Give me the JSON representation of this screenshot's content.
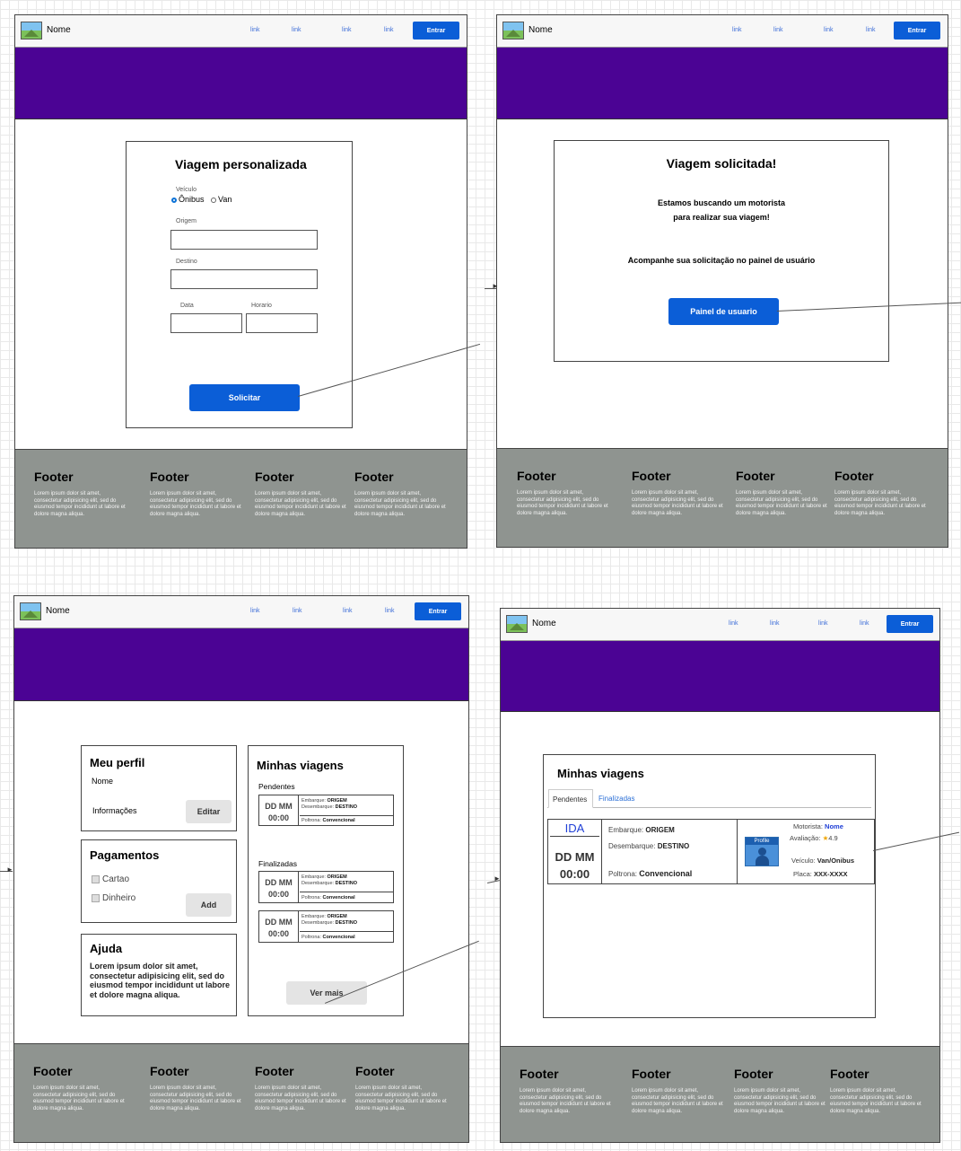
{
  "navbar": {
    "brand": "Nome",
    "links": [
      "link",
      "link",
      "link",
      "link"
    ],
    "login_button": "Entrar"
  },
  "footer": {
    "column_title": "Footer",
    "column_text": "Lorem ipsum dolor sit amet, consectetur adipisicing elit, sed do eiusmod tempor incididunt ut labore et dolore magna aliqua."
  },
  "screen1": {
    "title": "Viagem personalizada",
    "vehicle_label": "Veículo",
    "vehicle_options": [
      "Ônibus",
      "Van"
    ],
    "origin_label": "Origem",
    "destination_label": "Destino",
    "date_label": "Data",
    "time_label": "Horario",
    "submit_button": "Solicitar"
  },
  "screen2": {
    "title": "Viagem solicitada!",
    "message_line1": "Estamos buscando um motorista",
    "message_line2": "para realizar sua viagem!",
    "follow_text": "Acompanhe sua solicitação no painel de usuário",
    "panel_button": "Painel de usuario"
  },
  "screen3": {
    "profile": {
      "title": "Meu perfil",
      "name": "Nome",
      "info": "Informações",
      "edit_button": "Editar"
    },
    "payments": {
      "title": "Pagamentos",
      "options": [
        "Cartao",
        "Dinheiro"
      ],
      "add_button": "Add"
    },
    "help": {
      "title": "Ajuda",
      "text": "Lorem ipsum dolor sit amet, consectetur adipisicing elit, sed do eiusmod tempor incididunt ut labore et dolore magna aliqua."
    },
    "trips": {
      "title": "Minhas viagens",
      "pending_label": "Pendentes",
      "finished_label": "Finalizadas",
      "trip_day": "DD MM",
      "trip_time": "00:00",
      "boarding_label": "Embarque:",
      "boarding_value": "ORIGEM",
      "landing_label": "Desembarque:",
      "landing_value": "DESTINO",
      "seat_label": "Poltrona:",
      "seat_value": "Convencional",
      "more_button": "Ver mais"
    }
  },
  "screen4": {
    "title": "Minhas viagens",
    "tabs": [
      "Pendentes",
      "Finalizadas"
    ],
    "trip": {
      "direction": "IDA",
      "day": "DD MM",
      "time": "00:00",
      "boarding_label": "Embarque:",
      "boarding_value": "ORIGEM",
      "landing_label": "Desembarque:",
      "landing_value": "DESTINO",
      "seat_label": "Poltrona:",
      "seat_value": "Convencional"
    },
    "driver": {
      "profile_label": "Profile",
      "driver_label": "Motorista:",
      "driver_name": "Nome",
      "rating_label": "Avaliação:",
      "rating_value": "4.9",
      "vehicle_label": "Veículo:",
      "vehicle_value": "Van/Onibus",
      "plate_label": "Placa:",
      "plate_value": "XXX-XXXX"
    }
  },
  "colors": {
    "hero": "#4b0394",
    "primary": "#0b5ed7",
    "footer": "#8f9490",
    "link": "#3f6fd8"
  }
}
